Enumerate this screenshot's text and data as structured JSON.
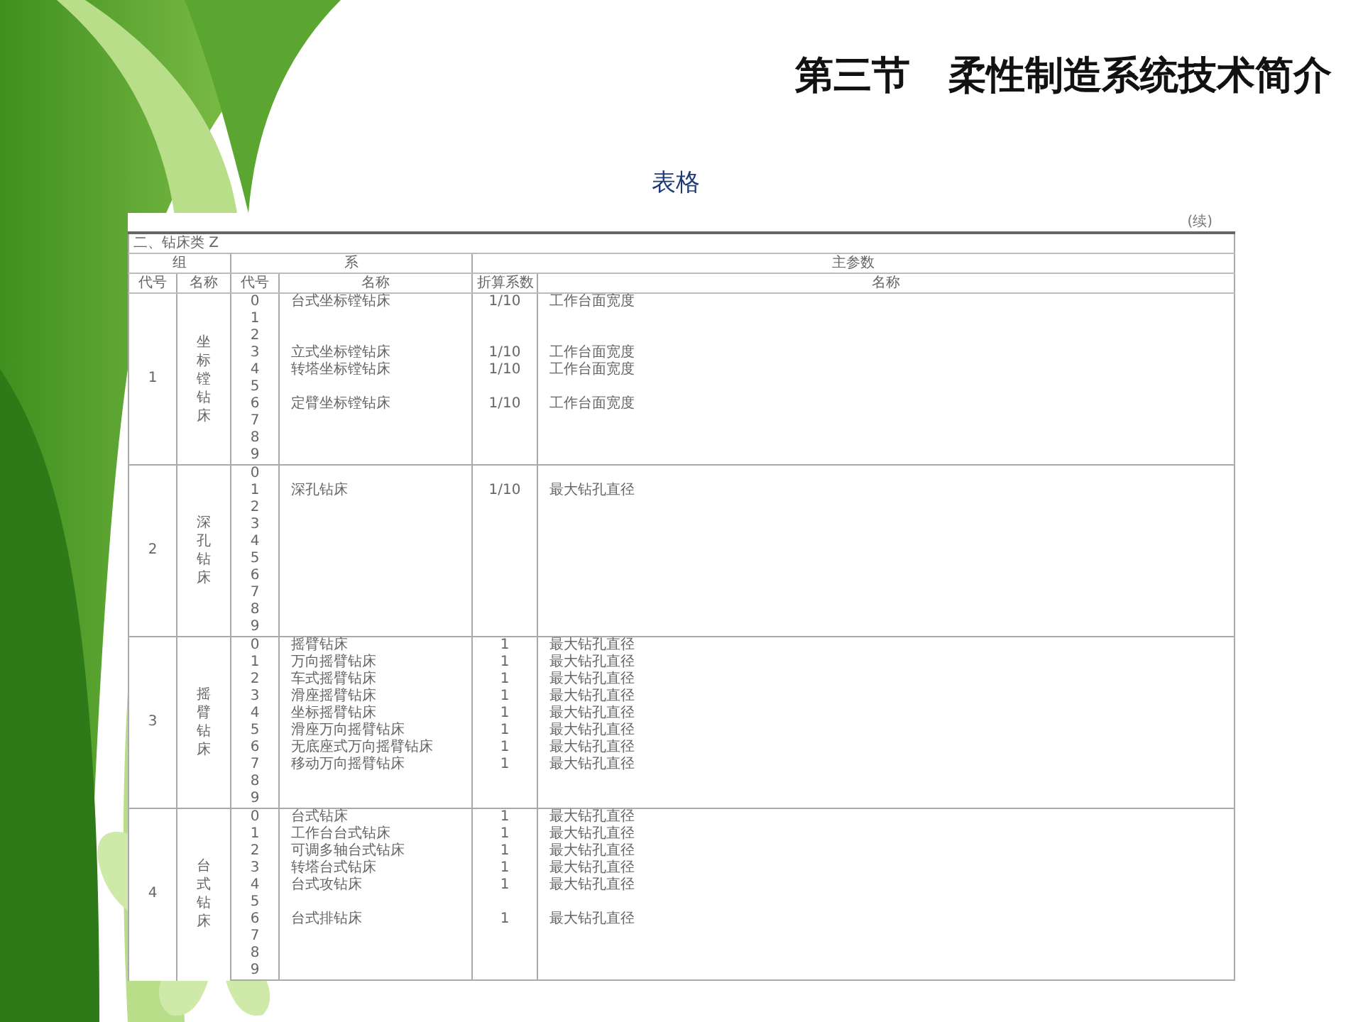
{
  "slide": {
    "title": "第三节　柔性制造系统技术简介",
    "subtitle": "表格"
  },
  "table": {
    "note": "(续)",
    "category": "二、钻床类 Z",
    "header_groups": [
      "组",
      "系",
      "主参数"
    ],
    "columns": [
      "代号",
      "名称",
      "代号",
      "名称",
      "折算系数",
      "名称"
    ],
    "groups": [
      {
        "code": "1",
        "name": "坐标镗钻床",
        "series": [
          {
            "code": "0",
            "name": "台式坐标镗钻床",
            "factor": "1/10",
            "param": "工作台面宽度"
          },
          {
            "code": "1"
          },
          {
            "code": "2"
          },
          {
            "code": "3",
            "name": "立式坐标镗钻床",
            "factor": "1/10",
            "param": "工作台面宽度"
          },
          {
            "code": "4",
            "name": "转塔坐标镗钻床",
            "factor": "1/10",
            "param": "工作台面宽度"
          },
          {
            "code": "5"
          },
          {
            "code": "6",
            "name": "定臂坐标镗钻床",
            "factor": "1/10",
            "param": "工作台面宽度"
          },
          {
            "code": "7"
          },
          {
            "code": "8"
          },
          {
            "code": "9"
          }
        ]
      },
      {
        "code": "2",
        "name": "深孔钻床",
        "series": [
          {
            "code": "0"
          },
          {
            "code": "1",
            "name": "深孔钻床",
            "factor": "1/10",
            "param": "最大钻孔直径"
          },
          {
            "code": "2"
          },
          {
            "code": "3"
          },
          {
            "code": "4"
          },
          {
            "code": "5"
          },
          {
            "code": "6"
          },
          {
            "code": "7"
          },
          {
            "code": "8"
          },
          {
            "code": "9"
          }
        ]
      },
      {
        "code": "3",
        "name": "摇臂钻床",
        "series": [
          {
            "code": "0",
            "name": "摇臂钻床",
            "factor": "1",
            "param": "最大钻孔直径"
          },
          {
            "code": "1",
            "name": "万向摇臂钻床",
            "factor": "1",
            "param": "最大钻孔直径"
          },
          {
            "code": "2",
            "name": "车式摇臂钻床",
            "factor": "1",
            "param": "最大钻孔直径"
          },
          {
            "code": "3",
            "name": "滑座摇臂钻床",
            "factor": "1",
            "param": "最大钻孔直径"
          },
          {
            "code": "4",
            "name": "坐标摇臂钻床",
            "factor": "1",
            "param": "最大钻孔直径"
          },
          {
            "code": "5",
            "name": "滑座万向摇臂钻床",
            "factor": "1",
            "param": "最大钻孔直径"
          },
          {
            "code": "6",
            "name": "无底座式万向摇臂钻床",
            "factor": "1",
            "param": "最大钻孔直径"
          },
          {
            "code": "7",
            "name": "移动万向摇臂钻床",
            "factor": "1",
            "param": "最大钻孔直径"
          },
          {
            "code": "8"
          },
          {
            "code": "9"
          }
        ]
      },
      {
        "code": "4",
        "name": "台式钻床",
        "series": [
          {
            "code": "0",
            "name": "台式钻床",
            "factor": "1",
            "param": "最大钻孔直径"
          },
          {
            "code": "1",
            "name": "工作台台式钻床",
            "factor": "1",
            "param": "最大钻孔直径"
          },
          {
            "code": "2",
            "name": "可调多轴台式钻床",
            "factor": "1",
            "param": "最大钻孔直径"
          },
          {
            "code": "3",
            "name": "转塔台式钻床",
            "factor": "1",
            "param": "最大钻孔直径"
          },
          {
            "code": "4",
            "name": "台式攻钻床",
            "factor": "1",
            "param": "最大钻孔直径"
          },
          {
            "code": "5"
          },
          {
            "code": "6",
            "name": "台式排钻床",
            "factor": "1",
            "param": "最大钻孔直径"
          },
          {
            "code": "7"
          },
          {
            "code": "8"
          },
          {
            "code": "9"
          }
        ]
      }
    ]
  }
}
